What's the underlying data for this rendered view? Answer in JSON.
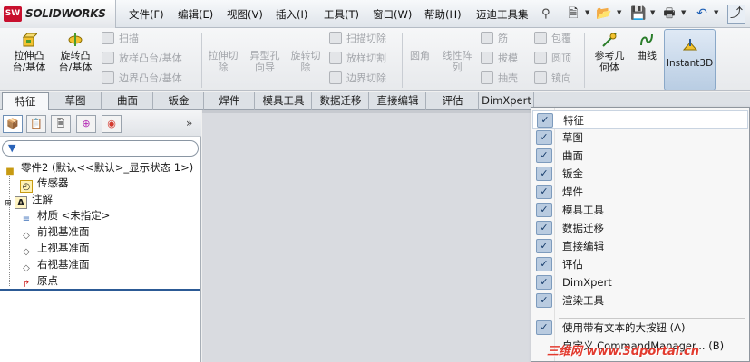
{
  "app": {
    "logo_text": "SOLIDWORKS",
    "logo_mark": "SW",
    "brand_color": "#c8102e"
  },
  "menu": [
    "文件(F)",
    "编辑(E)",
    "视图(V)",
    "插入(I)",
    "工具(T)",
    "窗口(W)",
    "帮助(H)",
    "迈迪工具集"
  ],
  "quick_access": [
    "new-doc-icon",
    "open-icon",
    "save-icon",
    "print-icon",
    "undo-icon",
    "select-arrow-icon"
  ],
  "ribbon": {
    "extrude_boss": "拉伸凸\n台/基体",
    "revolve_boss": "旋转凸\n台/基体",
    "sweep": "扫描",
    "loft": "放样凸台/基体",
    "boundary_boss": "边界凸台/基体",
    "extrude_cut": "拉伸切\n除",
    "hole_wizard": "异型孔\n向导",
    "revolve_cut": "旋转切\n除",
    "swept_cut": "扫描切除",
    "lofted_cut": "放样切割",
    "boundary_cut": "边界切除",
    "fillet": "圆角",
    "linear_pattern": "线性阵\n列",
    "rib": "筋",
    "draft": "拔模",
    "shell": "抽壳",
    "wrap": "包覆",
    "dome": "圆顶",
    "mirror": "镜向",
    "ref_geometry": "参考几\n何体",
    "curves": "曲线",
    "instant3d": "Instant3D"
  },
  "tabs": [
    "特征",
    "草图",
    "曲面",
    "钣金",
    "焊件",
    "模具工具",
    "数据迁移",
    "直接编辑",
    "评估",
    "DimXpert"
  ],
  "tree": {
    "part": "零件2 (默认<<默认>_显示状态 1>)",
    "items": [
      "传感器",
      "注解",
      "材质 <未指定>",
      "前视基准面",
      "上视基准面",
      "右视基准面",
      "原点"
    ]
  },
  "context_menu": {
    "items": [
      "特征",
      "草图",
      "曲面",
      "钣金",
      "焊件",
      "模具工具",
      "数据迁移",
      "直接编辑",
      "评估",
      "DimXpert",
      "渲染工具"
    ],
    "option": "使用带有文本的大按钮 (A)",
    "customize": "自定义 CommandManager... (B)"
  },
  "watermark": "三维网 www.3dportal.cn"
}
